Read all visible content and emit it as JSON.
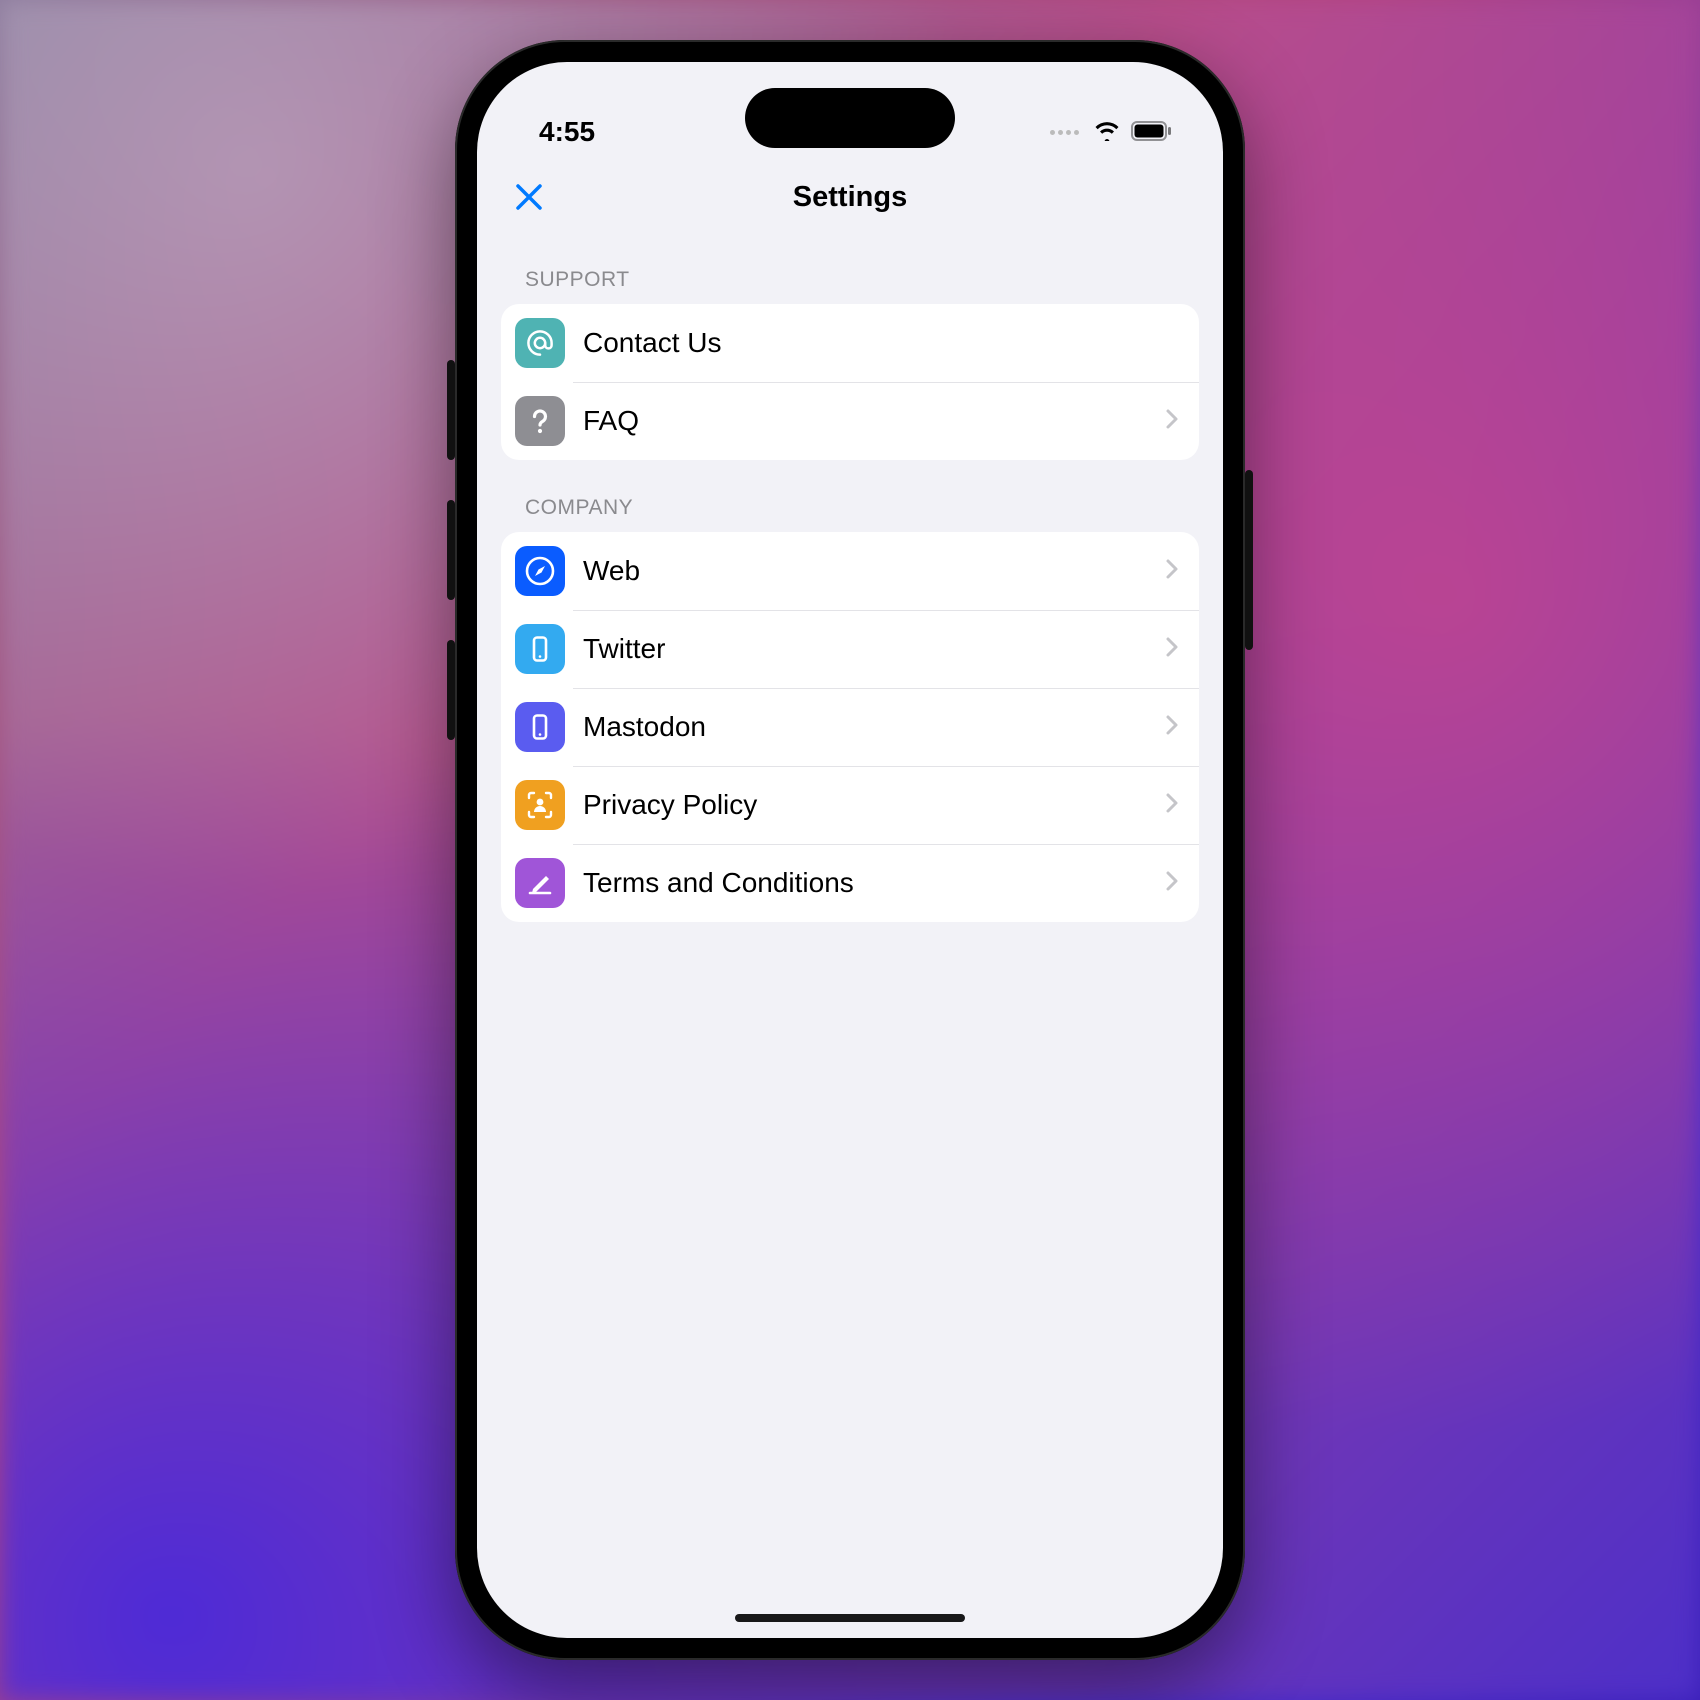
{
  "status": {
    "time": "4:55"
  },
  "nav": {
    "title": "Settings"
  },
  "sections": {
    "support": {
      "header": "SUPPORT",
      "items": {
        "contact": {
          "label": "Contact Us",
          "icon": "at-icon",
          "color": "#4fb3b3",
          "disclosure": false
        },
        "faq": {
          "label": "FAQ",
          "icon": "question-icon",
          "color": "#8e8e93",
          "disclosure": true
        }
      }
    },
    "company": {
      "header": "COMPANY",
      "items": {
        "web": {
          "label": "Web",
          "icon": "compass-icon",
          "color": "#0a5cff",
          "disclosure": true
        },
        "twitter": {
          "label": "Twitter",
          "icon": "phone-icon",
          "color": "#33aaf0",
          "disclosure": true
        },
        "mastodon": {
          "label": "Mastodon",
          "icon": "phone-icon",
          "color": "#5a5cf0",
          "disclosure": true
        },
        "privacy": {
          "label": "Privacy Policy",
          "icon": "person-frame-icon",
          "color": "#f0a020",
          "disclosure": true
        },
        "terms": {
          "label": "Terms and Conditions",
          "icon": "pencil-icon",
          "color": "#a055d8",
          "disclosure": true
        }
      }
    }
  }
}
